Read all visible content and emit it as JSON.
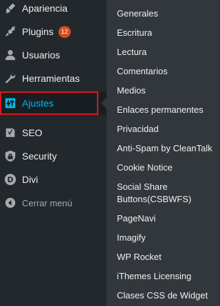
{
  "colors": {
    "menu_bg": "#23282d",
    "submenu_bg": "#32373c",
    "active_text": "#00b9eb",
    "highlight_border": "#e0161e",
    "badge_bg": "#d54e21"
  },
  "menu": {
    "items": [
      {
        "label": "Apariencia",
        "icon": "paintbrush-icon"
      },
      {
        "label": "Plugins",
        "icon": "plugin-icon",
        "badge": "12"
      },
      {
        "label": "Usuarios",
        "icon": "user-icon"
      },
      {
        "label": "Herramientas",
        "icon": "wrench-icon"
      },
      {
        "label": "Ajustes",
        "icon": "settings-icon",
        "active": true
      },
      {
        "label": "SEO",
        "icon": "seo-icon"
      },
      {
        "label": "Security",
        "icon": "shield-icon"
      },
      {
        "label": "Divi",
        "icon": "divi-icon"
      }
    ],
    "collapse_label": "Cerrar menú"
  },
  "submenu": {
    "items": [
      "Generales",
      "Escritura",
      "Lectura",
      "Comentarios",
      "Medios",
      "Enlaces permanentes",
      "Privacidad",
      "Anti-Spam by CleanTalk",
      "Cookie Notice",
      "Social Share Buttons(CSBWFS)",
      "PageNavi",
      "Imagify",
      "WP Rocket",
      "iThemes Licensing",
      "Clases CSS de Widget"
    ]
  }
}
